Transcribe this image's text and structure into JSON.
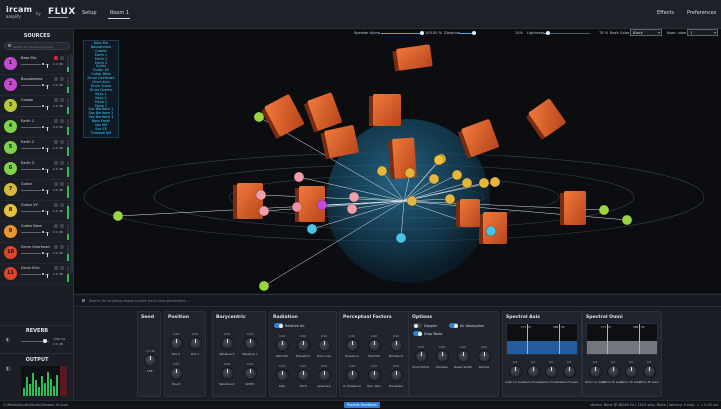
{
  "app": {
    "logo": "ircam",
    "logo_sub": "amplify",
    "by": "by",
    "vendor": "FLUX",
    "nav": {
      "setup": "Setup",
      "room": "Room 1",
      "effects": "Effects",
      "preferences": "Preferences"
    }
  },
  "sidebar": {
    "title": "SOURCES",
    "search_placeholder": "Search for source or group",
    "sources": [
      {
        "n": "1",
        "name": "Bass Mic",
        "color": "#c44bd0",
        "value": "0.0 dB",
        "level": 0.8,
        "mute": true
      },
      {
        "n": "2",
        "name": "Bouzandara",
        "color": "#c44bd0",
        "value": "0.0 dB",
        "level": 0.8,
        "mute": false
      },
      {
        "n": "3",
        "name": "Cowbe",
        "color": "#b7c93a",
        "value": "0.0 dB",
        "level": 0.8,
        "mute": false
      },
      {
        "n": "4",
        "name": "Earth 1",
        "color": "#7fd04a",
        "value": "0.0 dB",
        "level": 0.8,
        "mute": false
      },
      {
        "n": "5",
        "name": "Earth 2",
        "color": "#7fd04a",
        "value": "0.0 dB",
        "level": 0.8,
        "mute": false
      },
      {
        "n": "6",
        "name": "Earth 3",
        "color": "#7fd04a",
        "value": "0.0 dB",
        "level": 0.8,
        "mute": false
      },
      {
        "n": "7",
        "name": "Guitar",
        "color": "#d6b93b",
        "value": "0.0 dB",
        "level": 0.8,
        "mute": false
      },
      {
        "n": "8",
        "name": "Guitar XY",
        "color": "#e4c13a",
        "value": "0.0 dB",
        "level": 0.8,
        "mute": false
      },
      {
        "n": "9",
        "name": "Guitar Bass",
        "color": "#e8972f",
        "value": "0.0 dB",
        "level": 0.8,
        "mute": false
      },
      {
        "n": "10",
        "name": "Drum Overhead",
        "color": "#e0452a",
        "value": "0.0 dB",
        "level": 0.8,
        "mute": false
      },
      {
        "n": "11",
        "name": "Drum Kick",
        "color": "#e0452a",
        "value": "0.0 dB",
        "level": 0.8,
        "mute": false
      }
    ],
    "reverb": {
      "title": "REVERB",
      "value": "-288 ms",
      "value2": "0.0 dB",
      "level": 0.85
    },
    "output": {
      "title": "OUTPUT"
    }
  },
  "viewport": {
    "speaker_alpha_label": "Speaker Alpha",
    "speaker_alpha_value": "100.00 %",
    "distance_label": "Distance",
    "lightness_value": "10%",
    "lightness_label": "Lightness",
    "zoom_value": "75 %",
    "back_color_label": "Back Color",
    "back_color_value": "Black",
    "num_view_label": "Num. view",
    "num_view_value": "1",
    "names": [
      "Bass Mic",
      "Bouzandara",
      "Cowbe",
      "Earth 1",
      "Earth 2",
      "Earth 3",
      "Guitar",
      "Guitar XY",
      "Guitar Bass",
      "Drum Overhead",
      "Drum Kick",
      "Drum Snare",
      "Drum Overhe",
      "Keys 1",
      "Keys 2",
      "Piano 1",
      "Piano 2",
      "Sax Baritone 1",
      "Sax Baritone 2",
      "Sax Baritone 3",
      "Bass Email",
      "Sax KM",
      "Sax SP",
      "Trumpet KM"
    ]
  },
  "search": {
    "placeholder": "Search for anything about current track here parameters ..."
  },
  "params": {
    "send": {
      "title": "Send",
      "knobs": [
        {
          "label": "LFE",
          "value": "-inf dB"
        }
      ]
    },
    "position": {
      "title": "Position",
      "knobs": [
        {
          "label": "Pos X",
          "value": "0.00"
        },
        {
          "label": "Pos Y",
          "value": "0.00"
        },
        {
          "label": "Pos Z",
          "value": "0.00"
        }
      ]
    },
    "barycentric": {
      "title": "Barycentric",
      "knobs": [
        {
          "label": "Relative X",
          "value": "0.00"
        },
        {
          "label": "Relative Y",
          "value": "0.00"
        },
        {
          "label": "Relative Z",
          "value": "0.00"
        },
        {
          "label": "Width",
          "value": "0.00"
        }
      ]
    },
    "radiation": {
      "title": "Radiation",
      "toggle": "Relative dir.",
      "knobs": [
        {
          "label": "Azimuth",
          "value": "0.00"
        },
        {
          "label": "Elevation",
          "value": "0.00"
        },
        {
          "label": "Omni Lev",
          "value": "0.00"
        },
        {
          "label": "Size",
          "value": "0.00"
        },
        {
          "label": "Yitch",
          "value": "0.00"
        },
        {
          "label": "Aperture",
          "value": "0.00"
        }
      ]
    },
    "perceptual": {
      "title": "Perceptual Factors",
      "knobs": [
        {
          "label": "Presence",
          "value": "0.00"
        },
        {
          "label": "Warmth",
          "value": "0.00"
        },
        {
          "label": "Brilliance",
          "value": "0.00"
        },
        {
          "label": "R. Presence",
          "value": "0.00"
        },
        {
          "label": "Run. Rev",
          "value": "0.00"
        },
        {
          "label": "Envelope",
          "value": "0.00"
        }
      ]
    },
    "options": {
      "title": "Options",
      "doppler": "Doppler",
      "air_absorption": "Air Absorption",
      "drop_mode": "Drop Mode",
      "knobs": [
        {
          "label": "Drop Factor",
          "value": "0.00"
        },
        {
          "label": "Doubler",
          "value": "0.00"
        },
        {
          "label": "Delay Width",
          "value": "0.00"
        },
        {
          "label": "Radius",
          "value": "0.00"
        }
      ]
    },
    "spectral_axis": {
      "title": "Spectral Axis",
      "freq_left": "177 Hz",
      "freq_right": "5867 Hz",
      "knobs": [
        {
          "label": "Gain Lo Gain",
          "value": "0.0"
        },
        {
          "label": "Gain Hi Gain",
          "value": "0.0"
        },
        {
          "label": "Gain Hi Gain",
          "value": "0.0"
        },
        {
          "label": "Gain Hi Gain",
          "value": "0.0"
        }
      ]
    },
    "spectral_omni": {
      "title": "Spectral Omni",
      "freq_left": "177 Hz",
      "freq_right": "5867 Hz",
      "knobs": [
        {
          "label": "Omni Lo Gain",
          "value": "0.0"
        },
        {
          "label": "Omni Hi Gain",
          "value": "0.0"
        },
        {
          "label": "Omni Hi Gain",
          "value": "0.0"
        },
        {
          "label": "Omni Hi Gain",
          "value": "0.0"
        }
      ]
    }
  },
  "status": {
    "path": "C:\\Media\\Audio\\Studio\\Session 01.json",
    "feedback": "Provide Feedback",
    "device": "device: None @ 48000 Hz | 1024 smp, Block | latency: 0 smp - c = 0.00 ms"
  }
}
